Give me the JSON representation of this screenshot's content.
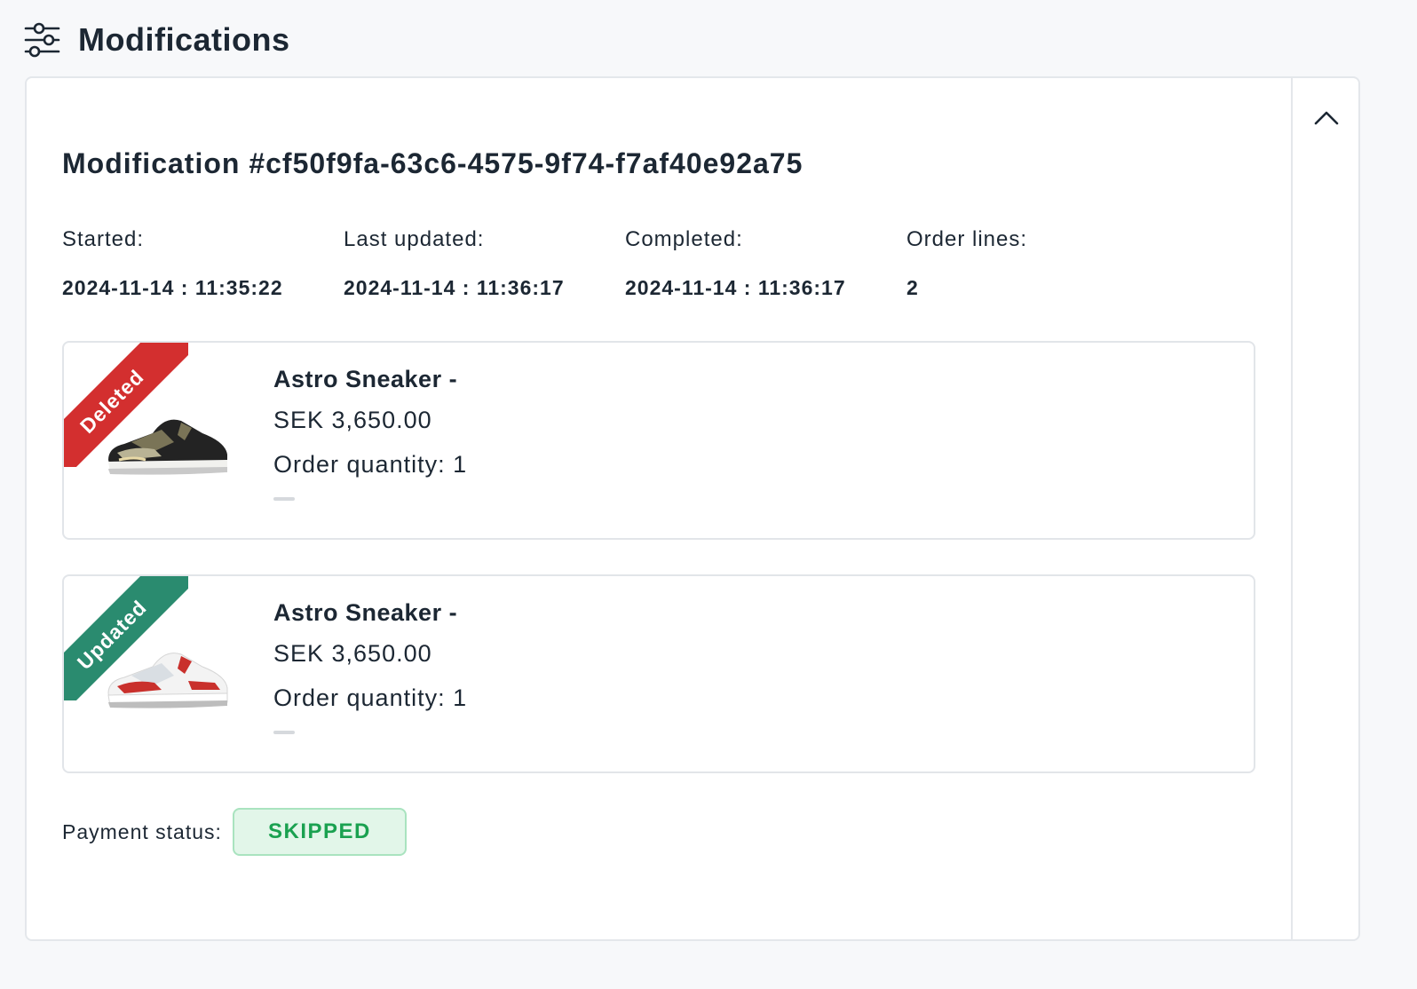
{
  "header": {
    "title": "Modifications",
    "icon": "sliders-icon"
  },
  "modification": {
    "title": "Modification #cf50f9fa-63c6-4575-9f74-f7af40e92a75",
    "meta": [
      {
        "label": "Started:",
        "value": "2024-11-14 : 11:35:22"
      },
      {
        "label": "Last updated:",
        "value": "2024-11-14 : 11:36:17"
      },
      {
        "label": "Completed:",
        "value": "2024-11-14 : 11:36:17"
      },
      {
        "label": "Order lines:",
        "value": "2"
      }
    ],
    "lines": [
      {
        "status": "Deleted",
        "name": "Astro Sneaker -",
        "price": "SEK 3,650.00",
        "quantity": "Order quantity: 1",
        "status_color": "#d32f2f"
      },
      {
        "status": "Updated",
        "name": "Astro Sneaker -",
        "price": "SEK 3,650.00",
        "quantity": "Order quantity: 1",
        "status_color": "#2a8b6f"
      }
    ],
    "payment": {
      "label": "Payment status:",
      "status": "SKIPPED",
      "status_color": "#1aa150"
    }
  },
  "controls": {
    "collapse_icon": "chevron-up-icon"
  }
}
